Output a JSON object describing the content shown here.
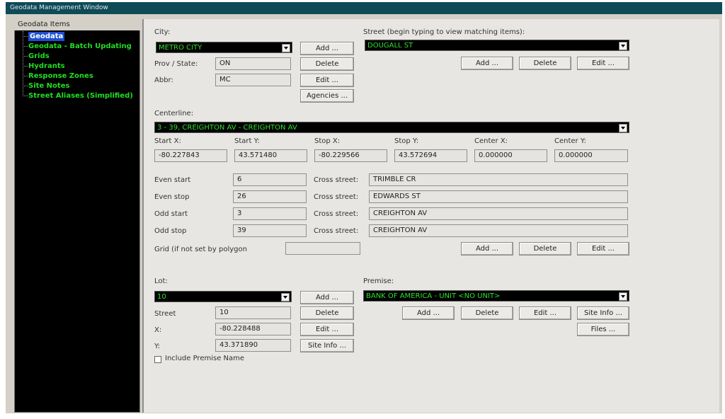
{
  "window": {
    "title": "Geodata Management Window"
  },
  "sidebar": {
    "header": "Geodata Items",
    "items": [
      {
        "label": "Geodata"
      },
      {
        "label": "Geodata - Batch Updating"
      },
      {
        "label": "Grids"
      },
      {
        "label": "Hydrants"
      },
      {
        "label": "Response Zones"
      },
      {
        "label": "Site Notes"
      },
      {
        "label": "Street Aliases (Simplified)"
      }
    ]
  },
  "city": {
    "label": "City:",
    "value": "METRO CITY",
    "prov_label": "Prov / State:",
    "prov_value": "ON",
    "abbr_label": "Abbr:",
    "abbr_value": "MC",
    "add": "Add ...",
    "delete": "Delete",
    "edit": "Edit ...",
    "agencies": "Agencies ..."
  },
  "street": {
    "label": "Street (begin typing to view matching items):",
    "value": "DOUGALL ST",
    "add": "Add ...",
    "delete": "Delete",
    "edit": "Edit ..."
  },
  "centerline": {
    "label": "Centerline:",
    "value": "3 - 39, CREIGHTON AV - CREIGHTON AV",
    "coords": [
      {
        "label": "Start X:",
        "value": "-80.227843"
      },
      {
        "label": "Start Y:",
        "value": "43.571480"
      },
      {
        "label": "Stop X:",
        "value": "-80.229566"
      },
      {
        "label": "Stop Y:",
        "value": "43.572694"
      },
      {
        "label": "Center X:",
        "value": "0.000000"
      },
      {
        "label": "Center Y:",
        "value": "0.000000"
      }
    ],
    "ranges": [
      {
        "label": "Even start",
        "value": "6",
        "cross_label": "Cross street:",
        "cross_value": "TRIMBLE CR"
      },
      {
        "label": "Even stop",
        "value": "26",
        "cross_label": "Cross street:",
        "cross_value": "EDWARDS ST"
      },
      {
        "label": "Odd start",
        "value": "3",
        "cross_label": "Cross street:",
        "cross_value": "CREIGHTON AV"
      },
      {
        "label": "Odd stop",
        "value": "39",
        "cross_label": "Cross street:",
        "cross_value": "CREIGHTON AV"
      }
    ],
    "grid_label": "Grid (if not set by polygon",
    "grid_value": "",
    "add": "Add ...",
    "delete": "Delete",
    "edit": "Edit ..."
  },
  "lot": {
    "label": "Lot:",
    "value": "10",
    "street_label": "Street",
    "street_value": "10",
    "x_label": "X:",
    "x_value": "-80.228488",
    "y_label": "Y:",
    "y_value": "43.371890",
    "add": "Add ...",
    "delete": "Delete",
    "edit": "Edit ...",
    "site_info": "Site Info ...",
    "include_premise_label": "Include Premise Name",
    "include_premise_checked": false
  },
  "premise": {
    "label": "Premise:",
    "value": "BANK OF AMERICA - UNIT <NO UNIT>",
    "add": "Add ...",
    "delete": "Delete",
    "edit": "Edit ...",
    "site_info": "Site Info ...",
    "files": "Files ..."
  }
}
